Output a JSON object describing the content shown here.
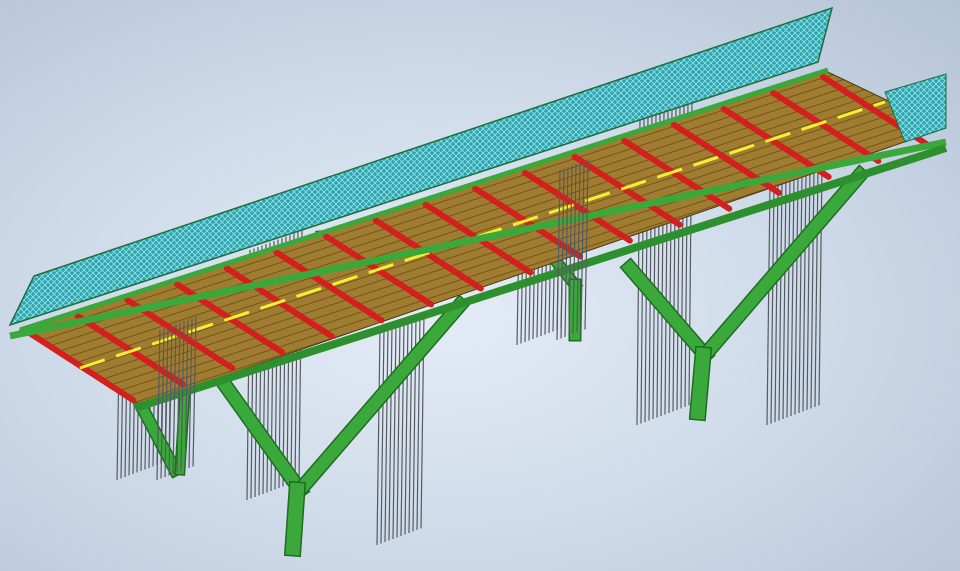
{
  "model": {
    "colors": {
      "background": "#d6e0ee",
      "railing": "#2aa6b0",
      "deck": "#9a7a2e",
      "cross_beam": "#d41f1f",
      "center_line": "#f2f030",
      "steel": "#3aa83a",
      "rebar": "#555a60"
    }
  }
}
